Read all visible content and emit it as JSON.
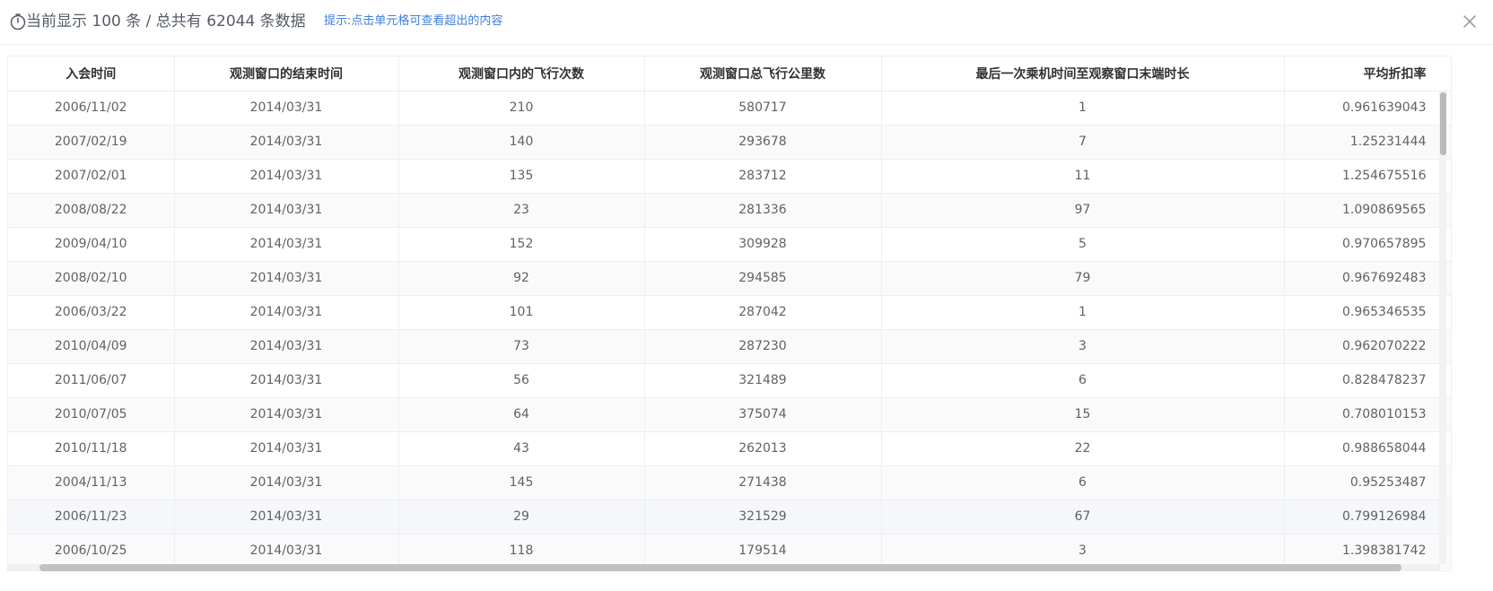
{
  "header": {
    "summary": "当前显示 100 条 / 总共有 62044 条数据",
    "hint": "提示:点击单元格可查看超出的内容"
  },
  "table": {
    "columns": [
      "入会时间",
      "观测窗口的结束时间",
      "观测窗口内的飞行次数",
      "观测窗口总飞行公里数",
      "最后一次乘机时间至观察窗口末端时长",
      "平均折扣率"
    ],
    "rows": [
      [
        "2006/11/02",
        "2014/03/31",
        "210",
        "580717",
        "1",
        "0.961639043"
      ],
      [
        "2007/02/19",
        "2014/03/31",
        "140",
        "293678",
        "7",
        "1.25231444"
      ],
      [
        "2007/02/01",
        "2014/03/31",
        "135",
        "283712",
        "11",
        "1.254675516"
      ],
      [
        "2008/08/22",
        "2014/03/31",
        "23",
        "281336",
        "97",
        "1.090869565"
      ],
      [
        "2009/04/10",
        "2014/03/31",
        "152",
        "309928",
        "5",
        "0.970657895"
      ],
      [
        "2008/02/10",
        "2014/03/31",
        "92",
        "294585",
        "79",
        "0.967692483"
      ],
      [
        "2006/03/22",
        "2014/03/31",
        "101",
        "287042",
        "1",
        "0.965346535"
      ],
      [
        "2010/04/09",
        "2014/03/31",
        "73",
        "287230",
        "3",
        "0.962070222"
      ],
      [
        "2011/06/07",
        "2014/03/31",
        "56",
        "321489",
        "6",
        "0.828478237"
      ],
      [
        "2010/07/05",
        "2014/03/31",
        "64",
        "375074",
        "15",
        "0.708010153"
      ],
      [
        "2010/11/18",
        "2014/03/31",
        "43",
        "262013",
        "22",
        "0.988658044"
      ],
      [
        "2004/11/13",
        "2014/03/31",
        "145",
        "271438",
        "6",
        "0.95253487"
      ],
      [
        "2006/11/23",
        "2014/03/31",
        "29",
        "321529",
        "67",
        "0.799126984"
      ],
      [
        "2006/10/25",
        "2014/03/31",
        "118",
        "179514",
        "3",
        "1.398381742"
      ]
    ]
  },
  "icons": {
    "timer": "timer-icon",
    "close": "close-icon"
  },
  "colors": {
    "hint": "#3e7fe0",
    "summary": "#555b66"
  }
}
